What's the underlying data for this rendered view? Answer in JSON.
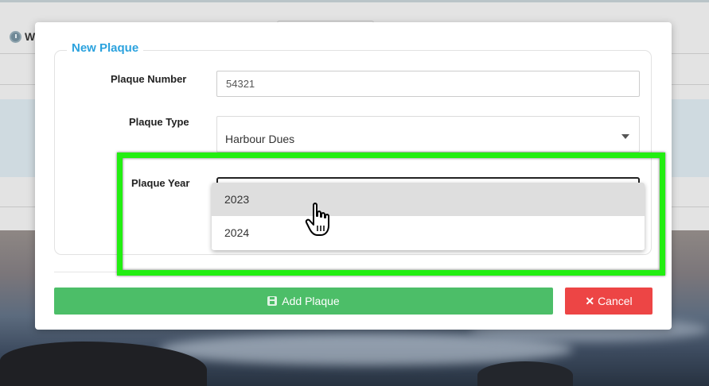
{
  "background": {
    "partial_text": "W"
  },
  "modal": {
    "legend": "New Plaque",
    "fields": {
      "plaque_number": {
        "label": "Plaque Number",
        "value": "54321"
      },
      "plaque_type": {
        "label": "Plaque Type",
        "value": "Harbour Dues"
      },
      "plaque_year": {
        "label": "Plaque Year",
        "options": [
          "2023",
          "2024"
        ],
        "hovered": "2023"
      }
    },
    "buttons": {
      "add": {
        "label": "Add Plaque",
        "icon": "save-icon"
      },
      "cancel": {
        "label": "Cancel",
        "icon": "close-icon",
        "glyph": "✕"
      }
    }
  },
  "colors": {
    "legend": "#2ba2de",
    "add_button": "#4cbe68",
    "cancel_button": "#ed4545",
    "highlight": "#22ee11"
  }
}
